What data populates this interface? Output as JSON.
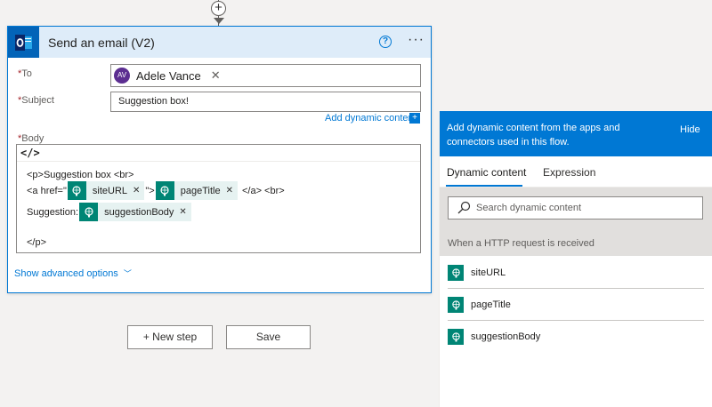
{
  "card": {
    "title": "Send an email (V2)",
    "help": "?",
    "more": "···"
  },
  "fields": {
    "to_label": "To",
    "to_recipient": {
      "initials": "AV",
      "name": "Adele Vance",
      "remove": "✕"
    },
    "subject_label": "Subject",
    "subject_value": "Suggestion box!",
    "add_dynamic": "Add dynamic content",
    "body_label": "Body",
    "code_toggle": "</>"
  },
  "body": {
    "line1": "<p>Suggestion box <br>",
    "line2_pre": "<a href=\"",
    "line2_mid": "\">",
    "line2_post": "</a> <br>",
    "line3_pre": "Suggestion:",
    "line4": "</p>",
    "tokens": {
      "siteURL": "siteURL",
      "pageTitle": "pageTitle",
      "suggestionBody": "suggestionBody",
      "remove": "✕"
    }
  },
  "advanced": {
    "label": "Show advanced options",
    "chevron": "﹀"
  },
  "buttons": {
    "new_step": "+ New step",
    "save": "Save"
  },
  "panel": {
    "header_text": "Add dynamic content from the apps and connectors used in this flow.",
    "hide": "Hide",
    "tabs": [
      "Dynamic content",
      "Expression"
    ],
    "search_placeholder": "Search dynamic content",
    "trigger_label": "When a HTTP request is received",
    "items": [
      "siteURL",
      "pageTitle",
      "suggestionBody"
    ]
  },
  "colors": {
    "accent": "#0078d4",
    "token_teal": "#008575",
    "avatar_purple": "#5c2e91"
  }
}
